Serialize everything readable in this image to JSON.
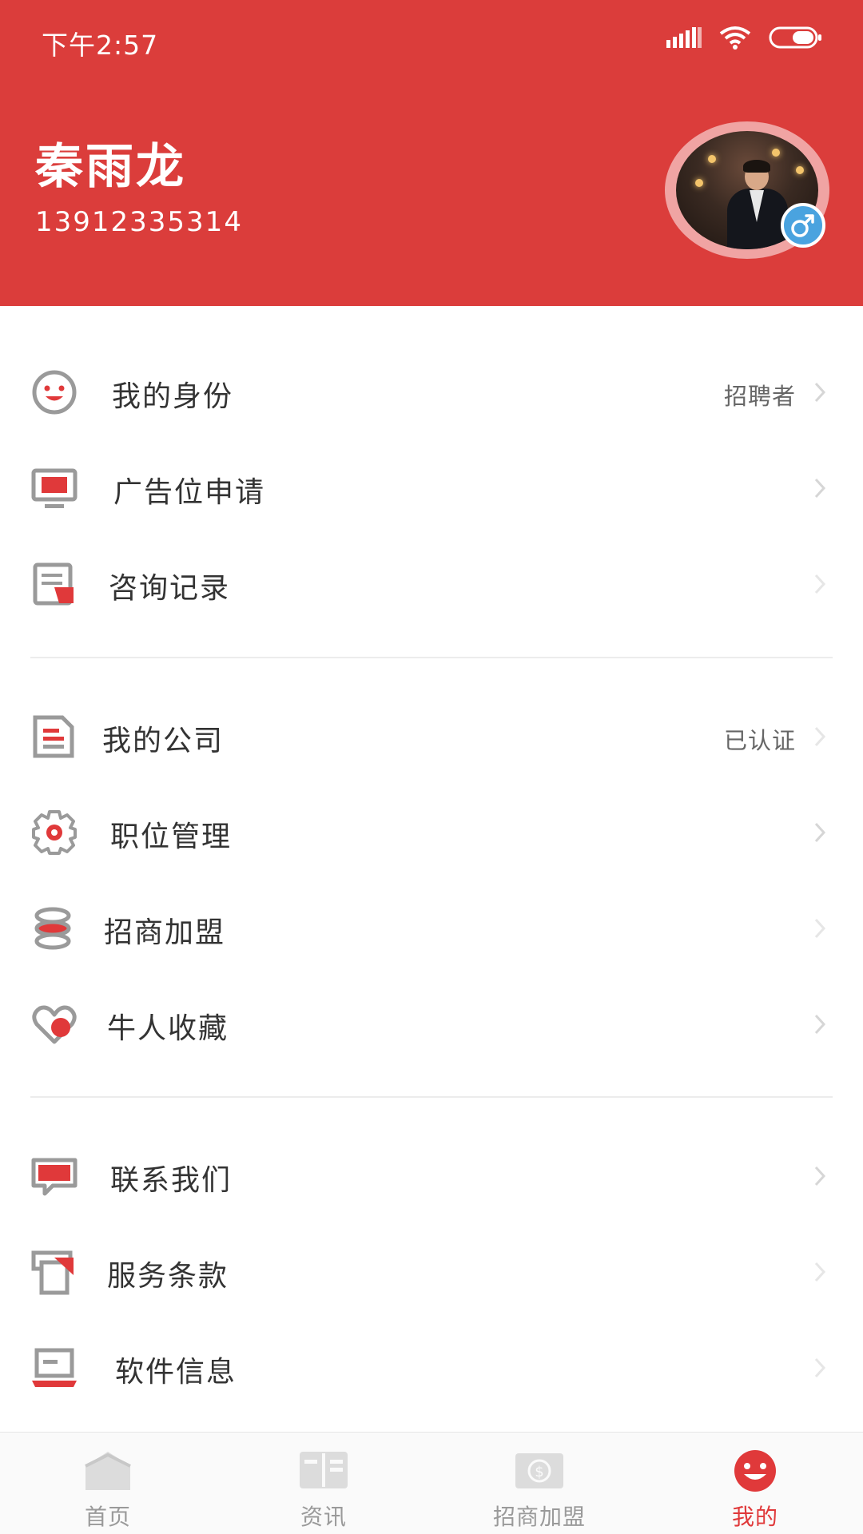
{
  "status_bar": {
    "time": "下午2:57"
  },
  "profile": {
    "name": "秦雨龙",
    "phone": "13912335314",
    "gender_symbol": "♂"
  },
  "menu": {
    "group1": [
      {
        "label": "我的身份",
        "value": "招聘者",
        "icon": "smiley-icon"
      },
      {
        "label": "广告位申请",
        "value": "",
        "icon": "monitor-icon"
      },
      {
        "label": "咨询记录",
        "value": "",
        "icon": "record-icon"
      }
    ],
    "group2": [
      {
        "label": "我的公司",
        "value": "已认证",
        "icon": "document-icon"
      },
      {
        "label": "职位管理",
        "value": "",
        "icon": "gear-icon"
      },
      {
        "label": "招商加盟",
        "value": "",
        "icon": "stack-icon"
      },
      {
        "label": "牛人收藏",
        "value": "",
        "icon": "heart-icon"
      }
    ],
    "group3": [
      {
        "label": "联系我们",
        "value": "",
        "icon": "chat-icon"
      },
      {
        "label": "服务条款",
        "value": "",
        "icon": "terms-icon"
      },
      {
        "label": "软件信息",
        "value": "",
        "icon": "laptop-icon"
      }
    ]
  },
  "tabbar": {
    "tabs": [
      {
        "label": "首页",
        "icon": "home-icon",
        "active": false
      },
      {
        "label": "资讯",
        "icon": "book-icon",
        "active": false
      },
      {
        "label": "招商加盟",
        "icon": "money-icon",
        "active": false
      },
      {
        "label": "我的",
        "icon": "smiley-icon",
        "active": true
      }
    ]
  },
  "colors": {
    "accent": "#db3d3b",
    "active_tab": "#e0393a",
    "text": "#333333",
    "muted": "#9a9a9a"
  }
}
